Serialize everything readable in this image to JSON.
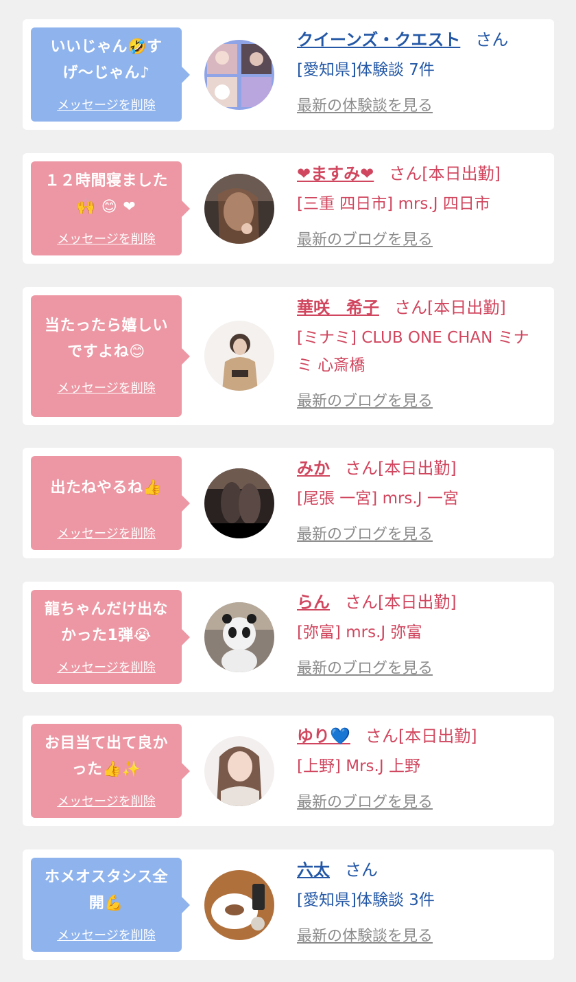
{
  "colors": {
    "page_bg": "#f0f0f0",
    "card_bg": "#ffffff",
    "bubble_blue": "#8fb3ec",
    "bubble_pink": "#ec97a3",
    "text_blue": "#2458a6",
    "text_pink": "#d0465e",
    "link_gray": "#8c8c8c"
  },
  "delete_label": "メッセージを削除",
  "items": [
    {
      "msg1": "いいじゃん🤣す",
      "msg2": "げ〜じゃん♪",
      "name": "クイーンズ・クエスト",
      "suffix": "さん",
      "sub1": "[愛知県]体験談 7件",
      "sub2": "",
      "link": "最新の体験談を見る"
    },
    {
      "msg1": "１２時間寝ました",
      "msg2": "🙌 😊 ❤",
      "name": "❤ますみ❤",
      "suffix": "さん[本日出勤]",
      "sub1": "[三重 四日市] mrs.J 四日市",
      "sub2": "",
      "link": "最新のブログを見る"
    },
    {
      "msg1": "当たったら嬉しい",
      "msg2": "ですよね😊",
      "name": "華咲　希子",
      "suffix": "さん[本日出勤]",
      "sub1": "[ミナミ] CLUB ONE CHAN ミナ",
      "sub2": "ミ 心斎橋",
      "link": "最新のブログを見る"
    },
    {
      "msg1": "出たねやるね👍",
      "msg2": "",
      "name": "みか",
      "suffix": "さん[本日出勤]",
      "sub1": "[尾張 一宮] mrs.J 一宮",
      "sub2": "",
      "link": "最新のブログを見る"
    },
    {
      "msg1": "龍ちゃんだけ出な",
      "msg2": "かった1弾😭",
      "name": "らん",
      "suffix": "さん[本日出勤]",
      "sub1": "[弥富] mrs.J 弥富",
      "sub2": "",
      "link": "最新のブログを見る"
    },
    {
      "msg1": "お目当て出て良か",
      "msg2": "った👍✨",
      "name": "ゆり💙",
      "suffix": "さん[本日出勤]",
      "sub1": "[上野] Mrs.J 上野",
      "sub2": "",
      "link": "最新のブログを見る"
    },
    {
      "msg1": "ホメオスタシス全",
      "msg2": "開💪",
      "name": "六太",
      "suffix": "さん",
      "sub1": "[愛知県]体験談 3件",
      "sub2": "",
      "link": "最新の体験談を見る"
    }
  ]
}
